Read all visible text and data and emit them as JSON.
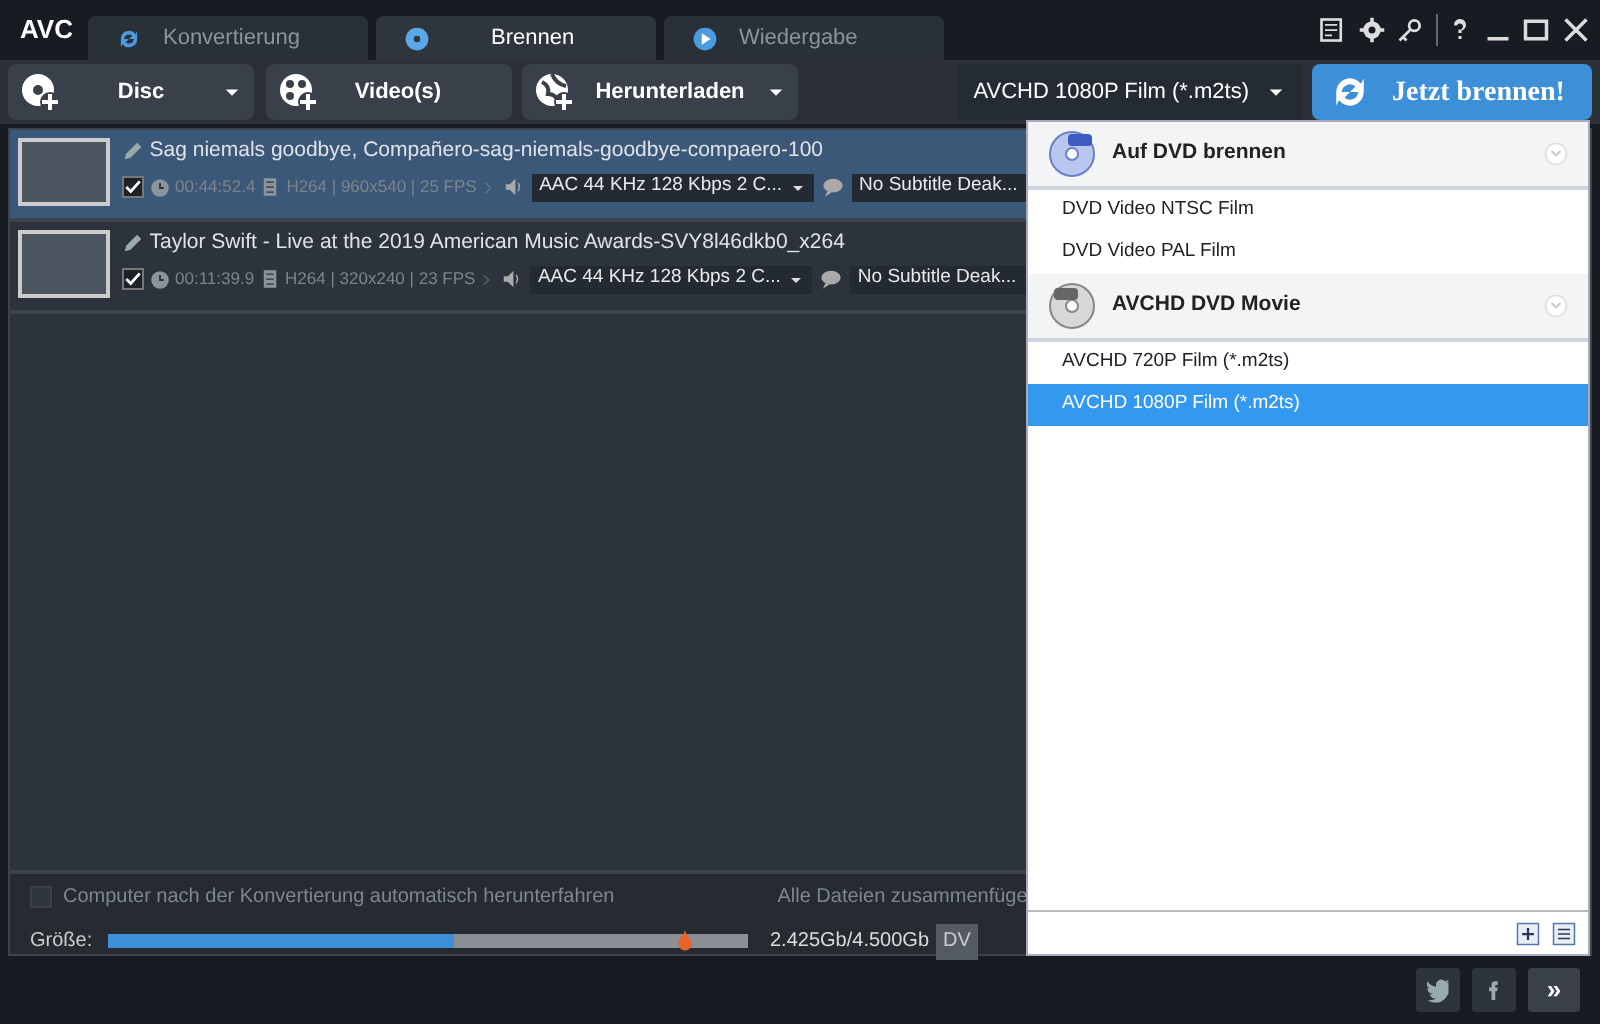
{
  "app": {
    "logo": "AVC"
  },
  "tabs": [
    {
      "label": "Konvertierung",
      "selected": false,
      "kind": "convert"
    },
    {
      "label": "Brennen",
      "selected": true,
      "kind": "burn"
    },
    {
      "label": "Wiedergabe",
      "selected": false,
      "kind": "play"
    }
  ],
  "toolbar": {
    "buttons": [
      {
        "label": "Disc",
        "kind": "disc",
        "has_menu": true
      },
      {
        "label": "Video(s)",
        "kind": "video",
        "has_menu": false
      },
      {
        "label": "Herunterladen",
        "kind": "download",
        "has_menu": true
      }
    ],
    "format_select": "AVCHD 1080P Film (*.m2ts)",
    "start_button": "Jetzt brennen!"
  },
  "files": [
    {
      "title": "Sag niemals goodbye, Compañero-sag-niemals-goodbye-compaero-100",
      "selected": true,
      "checked": true,
      "duration": "00:44:52.4",
      "video_info": "H264 | 960x540 | 25 FPS",
      "audio": "AAC 44 KHz 128 Kbps 2 C...",
      "subtitle": "No Subtitle Deak..."
    },
    {
      "title": "Taylor Swift - Live at the 2019 American Music Awards-SVY8l46dkb0_x264",
      "selected": false,
      "checked": true,
      "duration": "00:11:39.9",
      "video_info": "H264 | 320x240 | 23 FPS",
      "audio": "AAC 44 KHz 128 Kbps 2 C...",
      "subtitle": "No Subtitle Deak..."
    }
  ],
  "options": {
    "shutdown": {
      "label": "Computer nach der Konvertierung automatisch herunterfahren",
      "checked": false
    },
    "merge_label": "Alle Dateien zusammenfüge",
    "size_label": "Größe:",
    "size_bar": {
      "level": 0.54,
      "limit": {
        "level": 0.9
      }
    },
    "size_text": "2.425Gb/4.500Gb",
    "disc_button": "DV"
  },
  "format_menu": {
    "groups": [
      {
        "title": "Auf DVD brennen",
        "kind": "dvd",
        "items": [
          {
            "label": "DVD Video NTSC Film",
            "selected": false
          },
          {
            "label": "DVD Video PAL Film",
            "selected": false
          }
        ]
      },
      {
        "title": "AVCHD DVD Movie",
        "kind": "hd",
        "items": [
          {
            "label": "AVCHD 720P Film (*.m2ts)",
            "selected": false
          },
          {
            "label": "AVCHD 1080P Film (*.m2ts)",
            "selected": true
          }
        ]
      }
    ]
  },
  "footer": {
    "more_button": "»"
  }
}
